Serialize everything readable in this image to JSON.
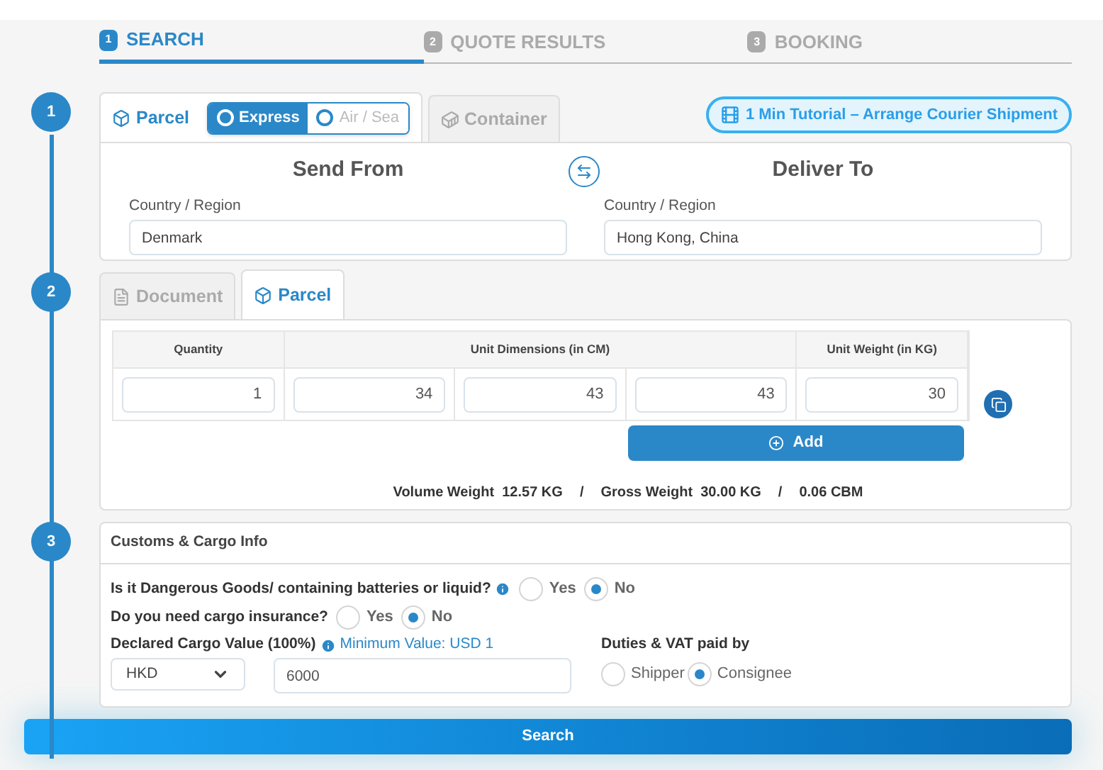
{
  "steps": [
    {
      "number": "1",
      "label": "SEARCH",
      "selected": true
    },
    {
      "number": "2",
      "label": "QUOTE RESULTS",
      "selected": false
    },
    {
      "number": "3",
      "label": "BOOKING",
      "selected": false
    }
  ],
  "timeline": [
    "1",
    "2",
    "3"
  ],
  "mode_tabs": [
    {
      "label": "Parcel",
      "kind": "parcel",
      "selected": true
    },
    {
      "label": "Container",
      "kind": "container",
      "selected": false
    }
  ],
  "service_options": [
    {
      "label": "Express",
      "selected": true
    },
    {
      "label": "Air / Sea",
      "selected": false
    }
  ],
  "tutorial_button": "1 Min Tutorial – Arrange Courier Shipment",
  "send_from": {
    "title": "Send From",
    "field_label": "Country / Region",
    "value": "Denmark"
  },
  "deliver_to": {
    "title": "Deliver To",
    "field_label": "Country / Region",
    "value": "Hong Kong, China"
  },
  "item_tabs": [
    {
      "label": "Document",
      "kind": "document",
      "selected": false
    },
    {
      "label": "Parcel",
      "kind": "parcel",
      "selected": true
    }
  ],
  "table": {
    "columns": [
      "Quantity",
      "Unit Dimensions (in CM)",
      "Unit Weight (in KG)"
    ],
    "row": [
      "1",
      "34",
      "43",
      "43",
      "30"
    ]
  },
  "add_button": "Add",
  "summary": [
    {
      "label": "Volume Weight",
      "value": "12.57 KG"
    },
    {
      "label": "Gross Weight",
      "value": "30.00 KG"
    },
    {
      "value": "0.06 CBM"
    }
  ],
  "summary_separator": "/",
  "customs": {
    "title": "Customs & Cargo Info",
    "questions": [
      {
        "text": "Is it Dangerous Goods/ containing batteries or liquid?",
        "info": true,
        "options": [
          {
            "label": "Yes",
            "selected": false
          },
          {
            "label": "No",
            "selected": true
          }
        ]
      },
      {
        "text": "Do you need cargo insurance?",
        "info": false,
        "options": [
          {
            "label": "Yes",
            "selected": false
          },
          {
            "label": "No",
            "selected": true
          }
        ]
      }
    ],
    "declared_label": "Declared Cargo Value (100%)",
    "minimum_note": "Minimum Value: USD 1",
    "currency": "HKD",
    "amount": "6000",
    "duties_label": "Duties & VAT paid by",
    "duties_options": [
      {
        "label": "Shipper",
        "selected": false
      },
      {
        "label": "Consignee",
        "selected": true
      }
    ]
  },
  "search_button": "Search"
}
